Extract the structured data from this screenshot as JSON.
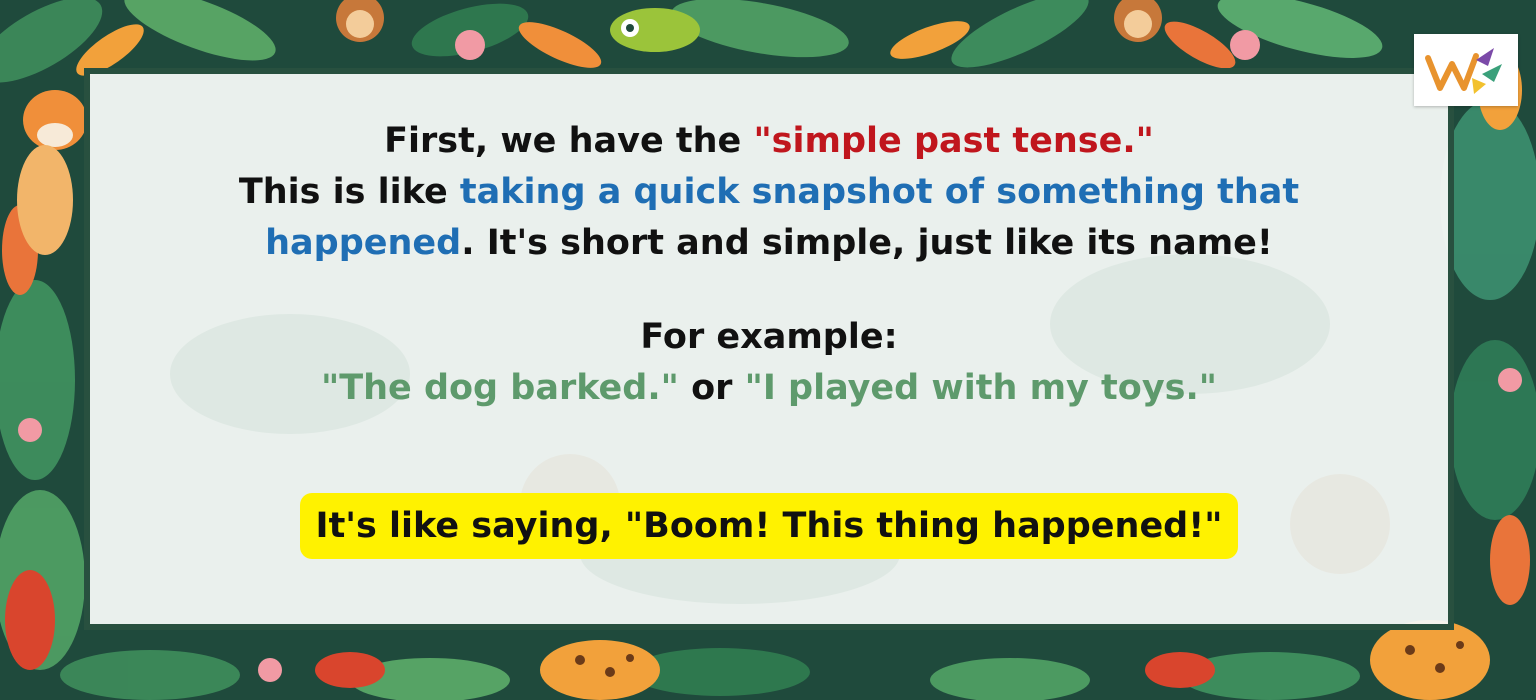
{
  "intro": {
    "line1_prefix": "First, we have the ",
    "line1_highlight": "\"simple past tense.\"",
    "line2_prefix": "This is like ",
    "line2_highlight": "taking a quick snapshot of something that",
    "line3_highlight": "happened",
    "line3_suffix": ". It's short and simple, just like its name!"
  },
  "example": {
    "heading": "For example:",
    "sample1": "\"The dog barked.\"",
    "connector": " or ",
    "sample2": "\"I played with my toys.\""
  },
  "callout": {
    "text": "It's like saying, \"Boom! This thing happened!\""
  },
  "colors": {
    "term_red": "#c0161d",
    "phrase_blue": "#1f6eb4",
    "example_green": "#5e9a6c",
    "callout_yellow": "#fff200",
    "frame_dark_green": "#28503f"
  },
  "decor": {
    "background": "jungle-pattern",
    "animals": [
      "tiger-icon",
      "monkey-icon",
      "chameleon-icon",
      "leopard-icon"
    ]
  }
}
